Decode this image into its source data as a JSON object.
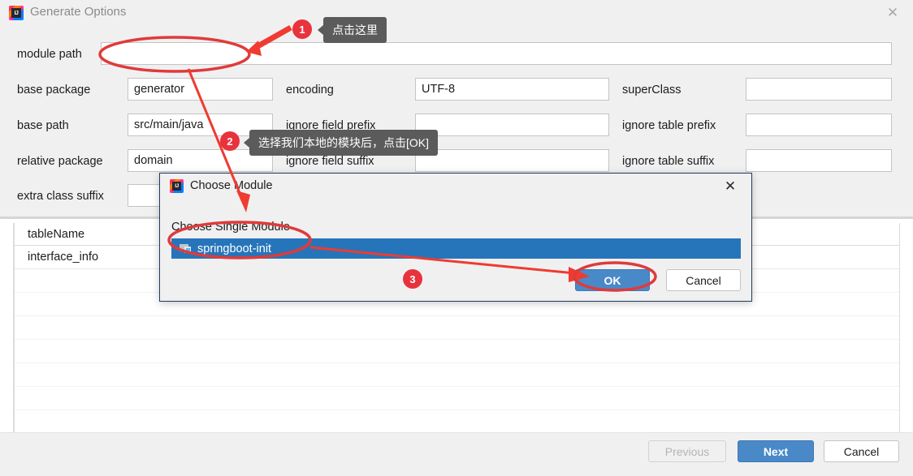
{
  "window": {
    "title": "Generate Options",
    "logo_text": "IJ",
    "logo_icon": "intellij-idea-icon",
    "close_icon": "close-icon"
  },
  "form": {
    "module_path": {
      "label": "module path",
      "value": "",
      "placeholder": ""
    },
    "base_package": {
      "label": "base package",
      "value": "generator",
      "placeholder": ""
    },
    "encoding": {
      "label": "encoding",
      "value": "UTF-8",
      "placeholder": ""
    },
    "super_class": {
      "label": "superClass",
      "value": "",
      "placeholder": ""
    },
    "base_path": {
      "label": "base path",
      "value": "src/main/java",
      "placeholder": ""
    },
    "ignore_field_prefix": {
      "label": "ignore field prefix",
      "value": "",
      "placeholder": ""
    },
    "ignore_table_prefix": {
      "label": "ignore table prefix",
      "value": "",
      "placeholder": ""
    },
    "relative_package": {
      "label": "relative package",
      "value": "domain",
      "placeholder": ""
    },
    "ignore_field_suffix": {
      "label": "ignore field suffix",
      "value": "",
      "placeholder": ""
    },
    "ignore_table_suffix": {
      "label": "ignore table suffix",
      "value": "",
      "placeholder": ""
    },
    "extra_class_suffix": {
      "label": "extra class suffix",
      "value": "",
      "placeholder": ""
    }
  },
  "table": {
    "columns": [
      "tableName"
    ],
    "rows": [
      [
        "interface_info"
      ]
    ]
  },
  "footer": {
    "previous_label": "Previous",
    "next_label": "Next",
    "cancel_label": "Cancel"
  },
  "dialog": {
    "title": "Choose Module",
    "logo_text": "IJ",
    "logo_icon": "intellij-idea-icon",
    "close_icon": "close-icon",
    "prompt": "Choose Single Module",
    "module_icon": "module-icon",
    "selected_module": "springboot-init",
    "ok_label": "OK",
    "cancel_label": "Cancel"
  },
  "annotations": {
    "step1": {
      "badge": "1",
      "tip": "点击这里"
    },
    "step2": {
      "badge": "2",
      "tip": "选择我们本地的模块后，点击[OK]"
    },
    "step3": {
      "badge": "3"
    }
  },
  "colors": {
    "accent_blue": "#4a89c8",
    "selection_blue": "#2675bb",
    "annotation_red": "#e8323c",
    "tooltip_gray": "#5b5b5b",
    "window_bg": "#f0f0f1"
  }
}
